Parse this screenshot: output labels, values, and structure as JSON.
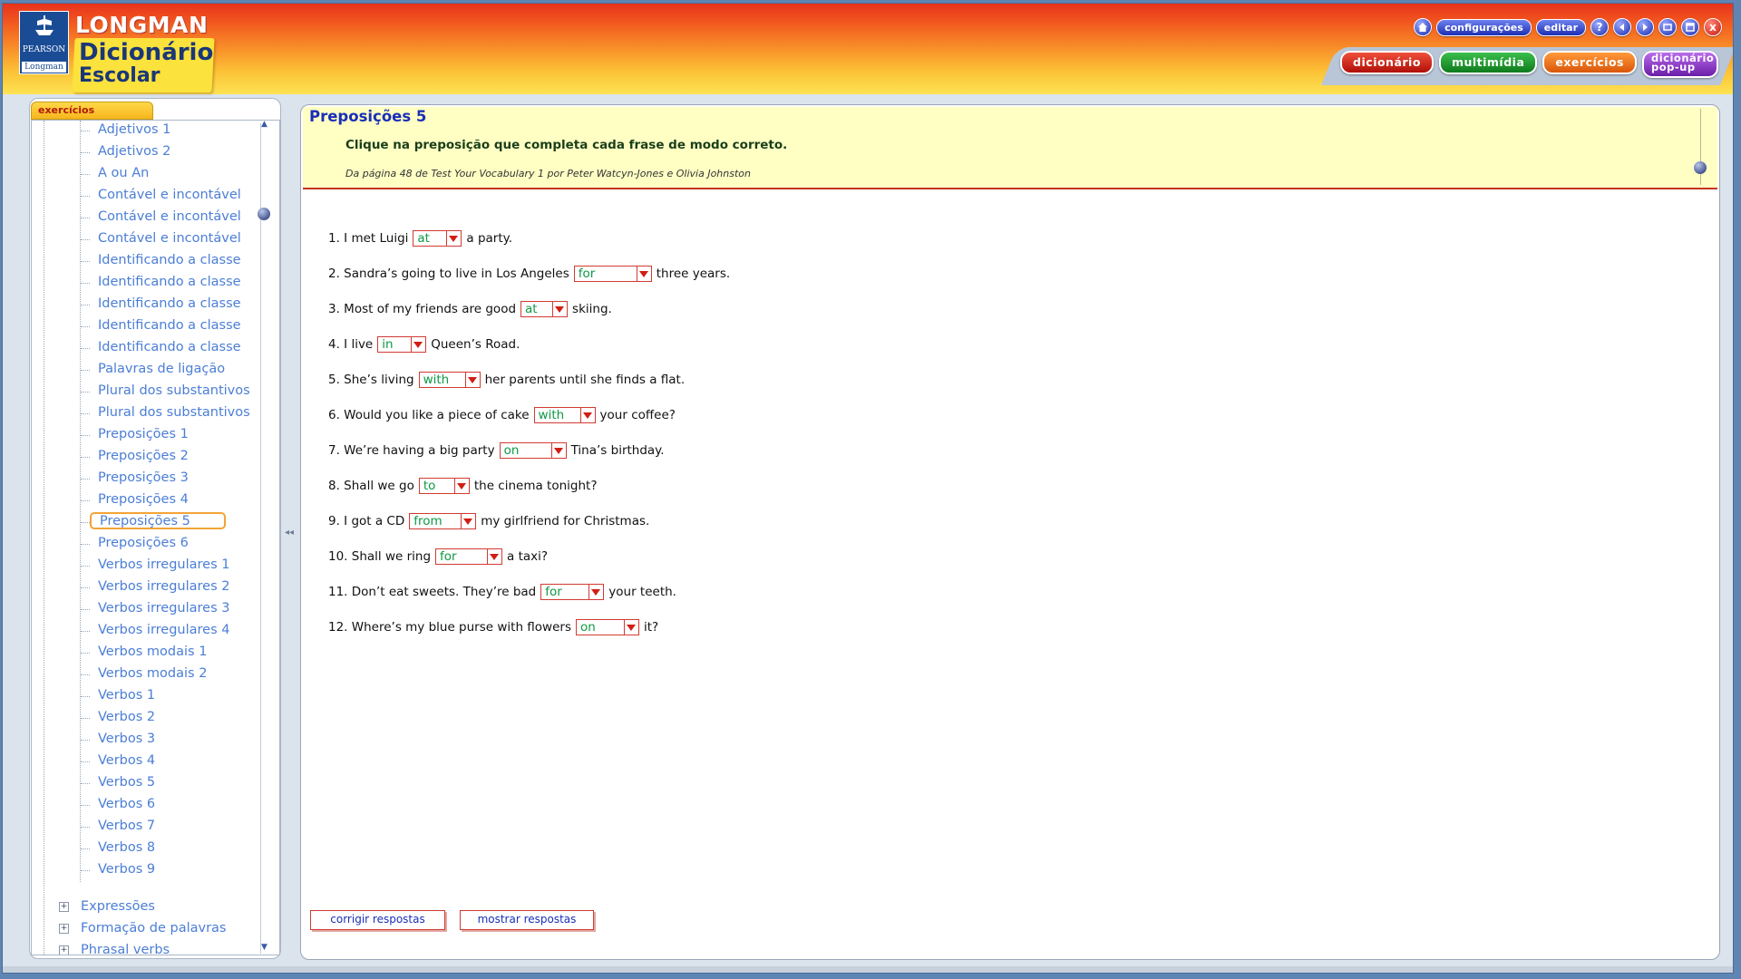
{
  "header": {
    "brand_top": "LONGMAN",
    "brand_title": "Dicionário",
    "brand_sub": "Escolar",
    "pearson": "PEARSON",
    "longman_small": "Longman",
    "top_buttons": {
      "config": "configurações",
      "edit": "editar",
      "help": "?",
      "close": "x"
    },
    "tabs": {
      "dictionary": "dicionário",
      "multimedia": "multimídia",
      "exercises": "exercícios",
      "popup_line1": "dicionário",
      "popup_line2": "pop-up"
    }
  },
  "sidebar": {
    "tab_label": "exercícios",
    "items": [
      "Adjetivos 1",
      "Adjetivos 2",
      "A ou An",
      "Contável e incontável",
      "Contável e incontável",
      "Contável e incontável",
      "Identificando a classe",
      "Identificando a classe",
      "Identificando a classe",
      "Identificando a classe",
      "Identificando a classe",
      "Palavras de ligação",
      "Plural dos substantivos",
      "Plural dos substantivos",
      "Preposições 1",
      "Preposições 2",
      "Preposições 3",
      "Preposições 4",
      "Preposições 5",
      "Preposições 6",
      "Verbos irregulares 1",
      "Verbos irregulares 2",
      "Verbos irregulares 3",
      "Verbos irregulares 4",
      "Verbos modais 1",
      "Verbos modais 2",
      "Verbos 1",
      "Verbos 2",
      "Verbos 3",
      "Verbos 4",
      "Verbos 5",
      "Verbos 6",
      "Verbos 7",
      "Verbos 8",
      "Verbos 9"
    ],
    "selected_index": 18,
    "groups": [
      "Expressões",
      "Formação de palavras",
      "Phrasal verbs"
    ]
  },
  "exercise": {
    "title": "Preposições 5",
    "instruction": "Clique na preposição que completa cada frase de modo correto.",
    "source": "Da página 48 de Test Your Vocabulary 1 por Peter Watcyn-Jones e Olivia Johnston",
    "questions": [
      {
        "before": "1. I met Luigi",
        "answer": "at",
        "after": "a party."
      },
      {
        "before": "2. Sandra’s going to live in Los Angeles",
        "answer": "for",
        "after": "three years."
      },
      {
        "before": "3. Most of my friends are good",
        "answer": "at",
        "after": "skiing."
      },
      {
        "before": "4. I live",
        "answer": "in",
        "after": "Queen’s Road."
      },
      {
        "before": "5. She’s living",
        "answer": "with",
        "after": "her parents until she finds a flat."
      },
      {
        "before": "6. Would you like a piece of cake",
        "answer": "with",
        "after": "your coffee?"
      },
      {
        "before": "7. We’re having a big party",
        "answer": "on",
        "after": "Tina’s birthday."
      },
      {
        "before": "8. Shall we go",
        "answer": "to",
        "after": "the cinema tonight?"
      },
      {
        "before": "9. I got a CD",
        "answer": "from",
        "after": "my girlfriend for Christmas."
      },
      {
        "before": "10. Shall we ring",
        "answer": "for",
        "after": "a taxi?"
      },
      {
        "before": "11. Don’t eat sweets. They’re bad",
        "answer": "for",
        "after": "your teeth."
      },
      {
        "before": "12. Where’s my blue purse with flowers",
        "answer": "on",
        "after": "it?"
      }
    ],
    "buttons": {
      "check": "corrigir respostas",
      "show": "mostrar respostas"
    }
  },
  "colors": {
    "answer_green": "#0d9a44",
    "link_blue": "#4b7ed6",
    "select_red": "#d23b32",
    "title_blue": "#1a2fb8"
  }
}
